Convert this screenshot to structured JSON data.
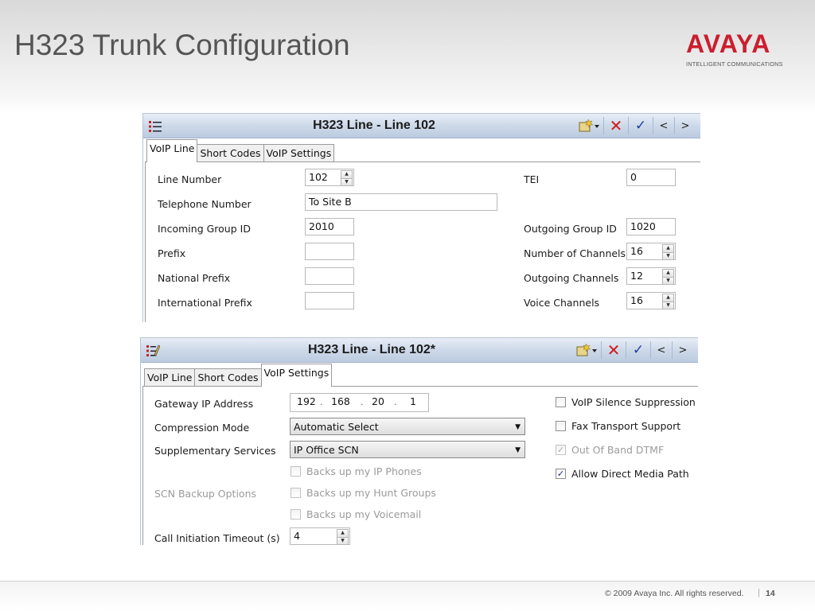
{
  "slide": {
    "title": "H323 Trunk Configuration"
  },
  "logo": {
    "word": "AVAYA",
    "tagline": "INTELLIGENT COMMUNICATIONS"
  },
  "toolbar": {
    "prev_label": "<",
    "next_label": ">"
  },
  "panel1": {
    "title": "H323 Line - Line 102",
    "tabs": [
      "VoIP Line",
      "Short Codes",
      "VoIP Settings"
    ],
    "active_tab": "VoIP Line",
    "fields": {
      "line_number": {
        "label": "Line Number",
        "value": "102"
      },
      "telephone_number": {
        "label": "Telephone Number",
        "value": "To Site B"
      },
      "incoming_group_id": {
        "label": "Incoming Group ID",
        "value": "2010"
      },
      "prefix": {
        "label": "Prefix",
        "value": ""
      },
      "national_prefix": {
        "label": "National Prefix",
        "value": ""
      },
      "international_prefix": {
        "label": "International Prefix",
        "value": ""
      },
      "tei": {
        "label": "TEI",
        "value": "0"
      },
      "outgoing_group_id": {
        "label": "Outgoing Group ID",
        "value": "1020"
      },
      "number_of_channels": {
        "label": "Number of Channels",
        "value": "16"
      },
      "outgoing_channels": {
        "label": "Outgoing Channels",
        "value": "12"
      },
      "voice_channels": {
        "label": "Voice Channels",
        "value": "16"
      }
    }
  },
  "panel2": {
    "title": "H323 Line - Line 102*",
    "tabs": [
      "VoIP Line",
      "Short Codes",
      "VoIP Settings"
    ],
    "active_tab": "VoIP Settings",
    "gateway_ip": {
      "label": "Gateway IP Address",
      "octets": [
        "192",
        "168",
        "20",
        "1"
      ]
    },
    "compression_mode": {
      "label": "Compression Mode",
      "value": "Automatic Select"
    },
    "supplementary_services": {
      "label": "Supplementary Services",
      "value": "IP Office SCN"
    },
    "scn_backup": {
      "label": "SCN Backup Options",
      "options": [
        {
          "label": "Backs up my IP Phones",
          "checked": false
        },
        {
          "label": "Backs up my Hunt Groups",
          "checked": false
        },
        {
          "label": "Backs up my Voicemail",
          "checked": false
        }
      ]
    },
    "call_initiation_timeout": {
      "label": "Call Initiation Timeout (s)",
      "value": "4"
    },
    "checkboxes": [
      {
        "label": "VoIP Silence Suppression",
        "checked": false,
        "enabled": true
      },
      {
        "label": "Fax Transport Support",
        "checked": false,
        "enabled": true
      },
      {
        "label": "Out Of Band DTMF",
        "checked": true,
        "enabled": false
      },
      {
        "label": "Allow Direct Media Path",
        "checked": true,
        "enabled": true
      }
    ]
  },
  "footer": {
    "copyright": "© 2009 Avaya Inc. All rights reserved.",
    "separator": "|",
    "page": "14"
  },
  "colors": {
    "brand": "#cc1d2d",
    "titlebar": "#cdd9e9",
    "title_text": "#555555"
  }
}
